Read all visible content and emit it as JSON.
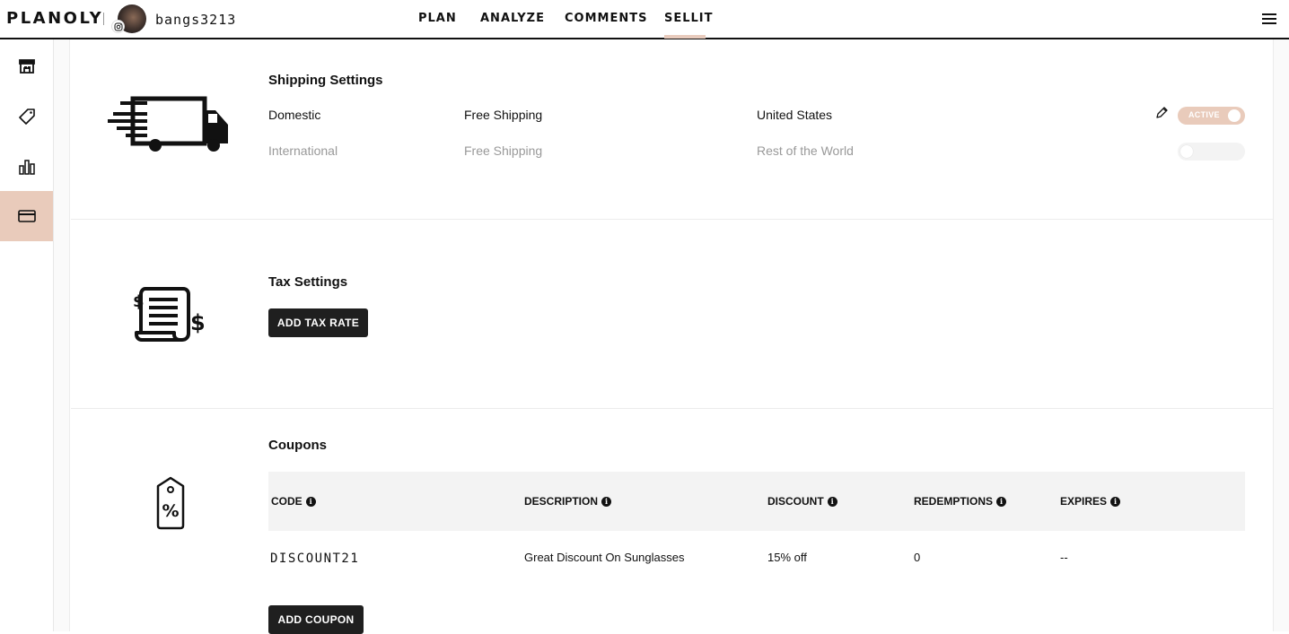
{
  "header": {
    "logo": "PLANOLY",
    "username": "bangs3213",
    "nav": [
      "PLAN",
      "ANALYZE",
      "COMMENTS",
      "SELLIT"
    ],
    "active_nav": "SELLIT"
  },
  "sidebar": {
    "items": [
      {
        "icon": "storefront-icon"
      },
      {
        "icon": "tag-icon"
      },
      {
        "icon": "bar-chart-icon"
      },
      {
        "icon": "credit-card-icon",
        "active": true
      }
    ]
  },
  "shipping": {
    "title": "Shipping Settings",
    "rows": [
      {
        "region": "Domestic",
        "method": "Free Shipping",
        "destination": "United States",
        "status": "ACTIVE",
        "active": true
      },
      {
        "region": "International",
        "method": "Free Shipping",
        "destination": "Rest of the World",
        "status": "",
        "active": false
      }
    ]
  },
  "tax": {
    "title": "Tax Settings",
    "add_button": "ADD TAX RATE"
  },
  "coupons": {
    "title": "Coupons",
    "columns": [
      "CODE",
      "DESCRIPTION",
      "DISCOUNT",
      "REDEMPTIONS",
      "EXPIRES"
    ],
    "rows": [
      {
        "code": "DISCOUNT21",
        "description": "Great Discount On Sunglasses",
        "discount": "15% off",
        "redemptions": "0",
        "expires": "--"
      }
    ],
    "add_button": "ADD COUPON"
  },
  "colors": {
    "accent": "#e9cbbb",
    "button": "#1f1f1f",
    "text": "#111111",
    "muted": "#999999"
  }
}
